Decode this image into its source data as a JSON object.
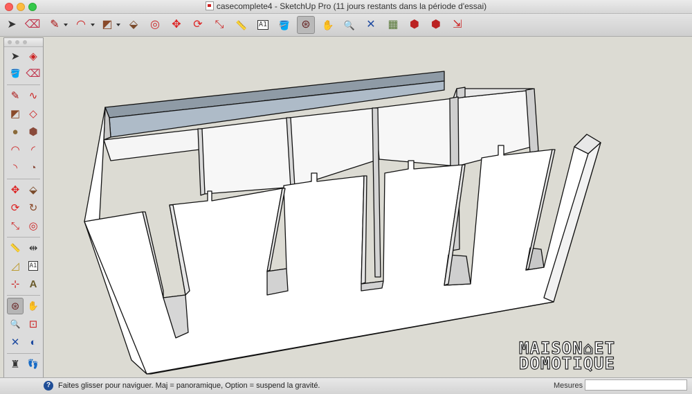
{
  "window": {
    "title": "casecomplete4 - SketchUp Pro (11 jours restants dans la période d'essai)"
  },
  "toolbar": {
    "tools": [
      {
        "name": "select-tool",
        "glyph": "➤"
      },
      {
        "name": "eraser-tool",
        "glyph": "⌫"
      },
      {
        "name": "pencil-tool",
        "glyph": "✎"
      },
      {
        "name": "arc-tool",
        "glyph": "◠"
      },
      {
        "name": "rectangle-tool",
        "glyph": "◩"
      },
      {
        "name": "push-pull-tool",
        "glyph": "⬙"
      },
      {
        "name": "offset-tool",
        "glyph": "◎"
      },
      {
        "name": "move-tool",
        "glyph": "✥"
      },
      {
        "name": "rotate-tool",
        "glyph": "⟳"
      },
      {
        "name": "scale-tool",
        "glyph": "⤡"
      },
      {
        "name": "tape-measure-tool",
        "glyph": "📏"
      },
      {
        "name": "text-tool",
        "glyph": "A1"
      },
      {
        "name": "paint-bucket-tool",
        "glyph": "🪣"
      },
      {
        "name": "orbit-tool",
        "glyph": "⊛"
      },
      {
        "name": "pan-tool",
        "glyph": "✋"
      },
      {
        "name": "zoom-tool",
        "glyph": "🔍"
      },
      {
        "name": "zoom-extents-tool",
        "glyph": "✕"
      },
      {
        "name": "geo-location-tool",
        "glyph": "▦"
      },
      {
        "name": "3d-warehouse-tool",
        "glyph": "⬢"
      },
      {
        "name": "share-model-tool",
        "glyph": "⬢"
      },
      {
        "name": "extension-warehouse-tool",
        "glyph": "⬢"
      },
      {
        "name": "send-to-layout-tool",
        "glyph": "⇲"
      }
    ]
  },
  "palette": {
    "tools": [
      {
        "name": "select-tool",
        "glyph": "➤"
      },
      {
        "name": "make-component-tool",
        "glyph": "◈"
      },
      {
        "name": "paint-bucket-tool",
        "glyph": "🪣"
      },
      {
        "name": "eraser-tool",
        "glyph": "⌫"
      },
      {
        "name": "line-tool",
        "glyph": "✎"
      },
      {
        "name": "freehand-tool",
        "glyph": "∿"
      },
      {
        "name": "rectangle-tool",
        "glyph": "◩"
      },
      {
        "name": "rotated-rectangle-tool",
        "glyph": "◇"
      },
      {
        "name": "circle-tool",
        "glyph": "●"
      },
      {
        "name": "polygon-tool",
        "glyph": "⬢"
      },
      {
        "name": "arc-tool",
        "glyph": "◠"
      },
      {
        "name": "two-point-arc-tool",
        "glyph": "◜"
      },
      {
        "name": "three-point-arc-tool",
        "glyph": "◝"
      },
      {
        "name": "pie-tool",
        "glyph": "◔"
      },
      {
        "name": "move-tool",
        "glyph": "✥"
      },
      {
        "name": "push-pull-tool",
        "glyph": "⬙"
      },
      {
        "name": "rotate-tool",
        "glyph": "⟳"
      },
      {
        "name": "follow-me-tool",
        "glyph": "↻"
      },
      {
        "name": "scale-tool",
        "glyph": "⤡"
      },
      {
        "name": "offset-tool",
        "glyph": "◎"
      },
      {
        "name": "tape-measure-tool",
        "glyph": "📏"
      },
      {
        "name": "dimension-tool",
        "glyph": "⇹"
      },
      {
        "name": "protractor-tool",
        "glyph": "◿"
      },
      {
        "name": "text-tool",
        "glyph": "A1"
      },
      {
        "name": "axes-tool",
        "glyph": "⊹"
      },
      {
        "name": "3d-text-tool",
        "glyph": "A"
      },
      {
        "name": "orbit-tool",
        "glyph": "⊛"
      },
      {
        "name": "pan-tool",
        "glyph": "✋"
      },
      {
        "name": "zoom-tool",
        "glyph": "🔍"
      },
      {
        "name": "zoom-window-tool",
        "glyph": "⊡"
      },
      {
        "name": "zoom-extents-tool",
        "glyph": "✕"
      },
      {
        "name": "previous-view-tool",
        "glyph": "◐"
      },
      {
        "name": "position-camera-tool",
        "glyph": "♜"
      },
      {
        "name": "walk-tool",
        "glyph": "👣"
      },
      {
        "name": "look-around-tool",
        "glyph": "👁"
      },
      {
        "name": "section-plane-tool",
        "glyph": "⊕"
      }
    ]
  },
  "status": {
    "help_glyph": "?",
    "hint": "Faites glisser pour naviguer. Maj = panoramique, Option =  suspend la gravité.",
    "measure_label": "Mesures",
    "measure_value": ""
  },
  "logo": {
    "line1": "MAISON⌂ET",
    "line2": "DOMOTIQUE"
  },
  "colors": {
    "model_face": "#f7f7f7",
    "model_shadow": "#b9b9b9",
    "back_panel": "#aebbc8",
    "background": "#dcdbd3"
  }
}
